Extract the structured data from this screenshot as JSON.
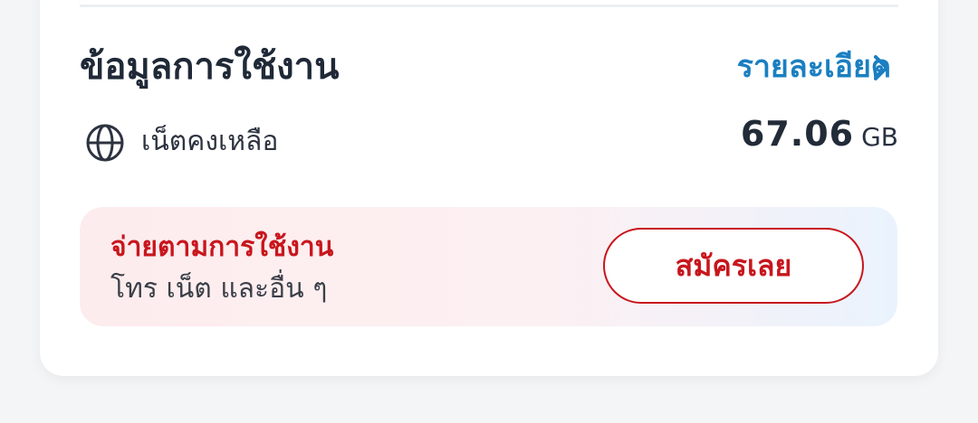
{
  "usage": {
    "title": "ข้อมูลการใช้งาน",
    "details_link": "รายละเอียด",
    "remaining_label": "เน็ตคงเหลือ",
    "remaining_value": "67.06",
    "remaining_unit": "GB"
  },
  "promo": {
    "title": "จ่ายตามการใช้งาน",
    "subtitle": "โทร เน็ต และอื่น ๆ",
    "button_label": "สมัครเลย"
  },
  "colors": {
    "accent_blue": "#1a7fc1",
    "accent_red": "#c8161d"
  },
  "icons": {
    "globe": "globe-icon",
    "chevron": "chevron-right-icon"
  }
}
